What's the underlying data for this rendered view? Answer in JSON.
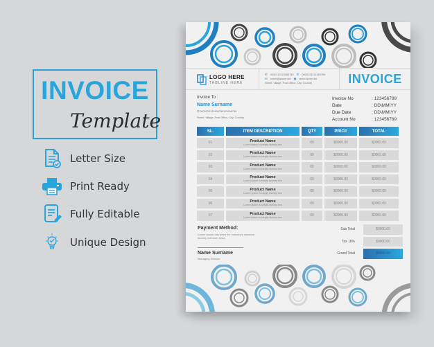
{
  "promo": {
    "title": "INVOICE",
    "subtitle": "Template",
    "features": [
      {
        "icon": "document-check-icon",
        "label": "Letter Size"
      },
      {
        "icon": "printer-icon",
        "label": "Print Ready"
      },
      {
        "icon": "edit-document-icon",
        "label": "Fully Editable"
      },
      {
        "icon": "lightbulb-icon",
        "label": "Unique Design"
      }
    ]
  },
  "colors": {
    "accent": "#2aa5dc",
    "accent_dark": "#2d6fae",
    "ring_dark": "#444444",
    "ring_gray": "#bdbdbd",
    "background": "#d6d7d9",
    "paper": "#f1f1f1"
  },
  "invoice": {
    "logo": {
      "name": "LOGO HERE",
      "tagline": "TAGLINE HERE"
    },
    "contact": {
      "phone1": "0000123123456789",
      "phone2": "0000123214456789",
      "email": "lorem@ipsum.dot",
      "web": "www.loremi.dot",
      "address": "Street, Village, Post Office, City, Country"
    },
    "heading": "INVOICE",
    "bill_to": {
      "label": "Invoice To :",
      "name": "Name Surname",
      "phone": "0000123123456789123456789",
      "address": "Street, Village, Post Office, City, Country"
    },
    "meta": [
      {
        "key": "Invoice No",
        "value": ": 123456789"
      },
      {
        "key": "Date",
        "value": ": DD\\MM\\YY"
      },
      {
        "key": "Due Date",
        "value": ": DD\\MM\\YY"
      },
      {
        "key": "Account No",
        "value": ": 123456789"
      }
    ],
    "table": {
      "headers": [
        "SL.",
        "ITEM DESCRIPTION",
        "QTY",
        "PRICE",
        "TOTAL"
      ],
      "rows": [
        {
          "sl": "01",
          "name": "Product Name",
          "desc": "Lorem Ipsum is simply dummy text",
          "qty": "00",
          "price": "$0000.00",
          "total": "$0000.00"
        },
        {
          "sl": "02",
          "name": "Product Name",
          "desc": "Lorem Ipsum is simply dummy text",
          "qty": "00",
          "price": "$0000.00",
          "total": "$0000.00"
        },
        {
          "sl": "03",
          "name": "Product Name",
          "desc": "Lorem Ipsum is simply dummy text",
          "qty": "00",
          "price": "$0000.00",
          "total": "$0000.00"
        },
        {
          "sl": "04",
          "name": "Product Name",
          "desc": "Lorem Ipsum is simply dummy text",
          "qty": "00",
          "price": "$0000.00",
          "total": "$0000.00"
        },
        {
          "sl": "05",
          "name": "Product Name",
          "desc": "Lorem Ipsum is simply dummy text",
          "qty": "00",
          "price": "$0000.00",
          "total": "$0000.00"
        },
        {
          "sl": "06",
          "name": "Product Name",
          "desc": "Lorem Ipsum is simply dummy text",
          "qty": "00",
          "price": "$0000.00",
          "total": "$0000.00"
        },
        {
          "sl": "07",
          "name": "Product Name",
          "desc": "Lorem Ipsum is simply dummy text",
          "qty": "00",
          "price": "$0000.00",
          "total": "$0000.00"
        }
      ]
    },
    "payment": {
      "title": "Payment Method:",
      "text": "Lorem Ipsum has been the industry's standard dummy text ever since"
    },
    "signature": {
      "name": "Name Surname",
      "role": "Managing Director"
    },
    "totals": [
      {
        "label": "Sub Total",
        "value": "$0000.00"
      },
      {
        "label": "Tax 15%",
        "value": "$0000.00"
      },
      {
        "label": "Grand Total",
        "value": "$0000.00"
      }
    ]
  }
}
